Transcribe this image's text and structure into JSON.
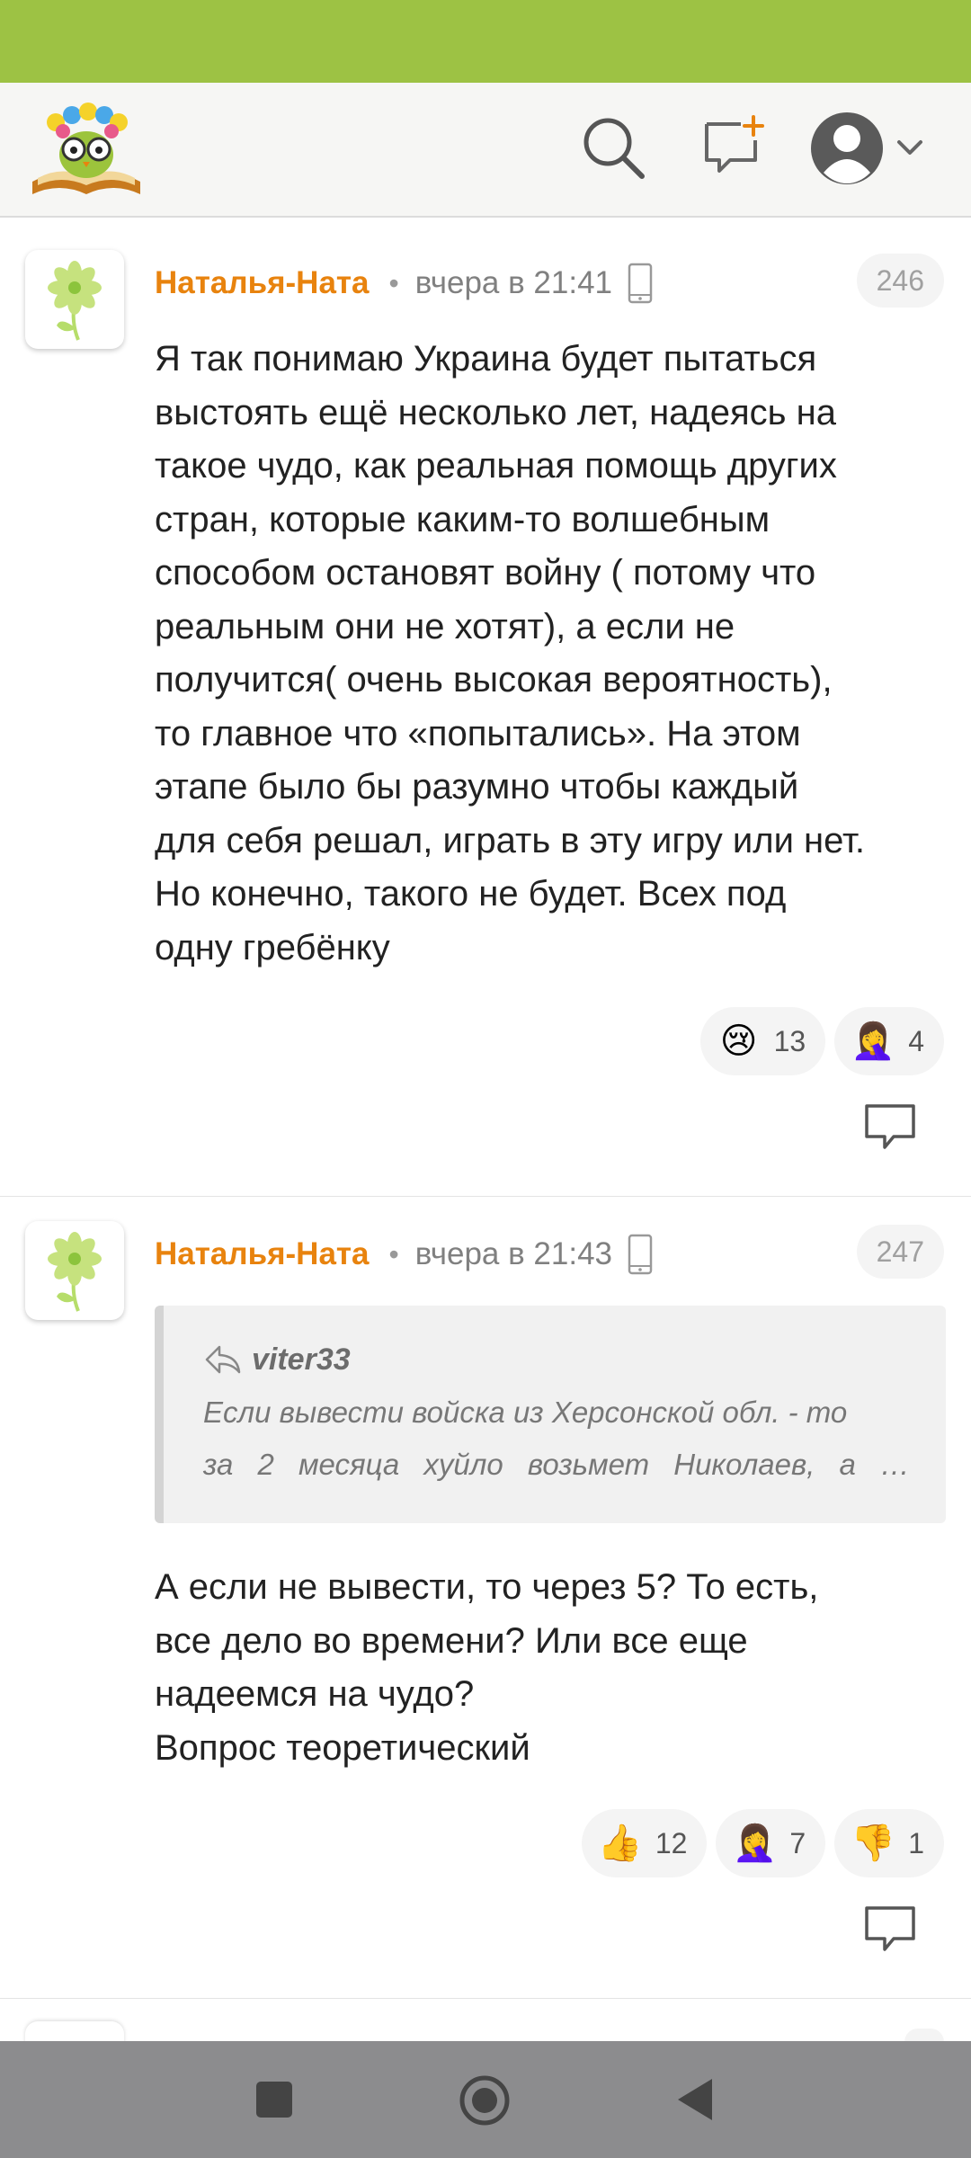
{
  "header": {
    "logo_name": "book-owl-logo",
    "icons": [
      "search-icon",
      "new-message-icon",
      "profile-avatar-icon",
      "chevron-down-icon"
    ]
  },
  "comments": [
    {
      "author": "Наталья-Ната",
      "time": "вчера в 21:41",
      "number": "246",
      "text_lines": [
        "Я так понимаю Украина будет пытаться",
        "выстоять ещё несколько лет, надеясь на",
        "такое чудо, как реальная помощь других",
        "стран, которые каким-то волшебным",
        "способом остановят войну ( потому что",
        "реальным они не хотят), а если не",
        "получится( очень высокая вероятность),",
        "то главное что «попытались». На этом",
        "этапе было бы разумно чтобы каждый",
        "для себя решал, играть в эту игру или нет.",
        "Но конечно, такого не будет. Всех под",
        "одну гребёнку"
      ],
      "reactions": [
        {
          "emoji": "😢",
          "count": "13"
        },
        {
          "emoji": "🤦‍♀️",
          "count": "4"
        }
      ]
    },
    {
      "author": "Наталья-Ната",
      "time": "вчера в 21:43",
      "number": "247",
      "quote": {
        "author": "viter33",
        "line1": "Если вывести войска из Херсонской обл. - то",
        "line2_words": [
          "за",
          "2",
          "месяца",
          "хуйло",
          "возьмет",
          "Николаев,",
          "а",
          "…"
        ]
      },
      "text_lines": [
        "А если не вывести, то через 5? То есть,",
        "все дело во времени? Или все еще",
        "надеемся на чудо?",
        "Вопрос теоретический"
      ],
      "reactions": [
        {
          "emoji": "👍",
          "count": "12"
        },
        {
          "emoji": "🤦‍♀️",
          "count": "7"
        },
        {
          "emoji": "👎",
          "count": "1"
        }
      ]
    }
  ],
  "navbar": {
    "icons": [
      "recents-square-icon",
      "home-circle-icon",
      "back-triangle-icon"
    ]
  },
  "colors": {
    "status_bar": "#9dc244",
    "author": "#e8830e",
    "nav_bar": "#8c8c8e"
  }
}
